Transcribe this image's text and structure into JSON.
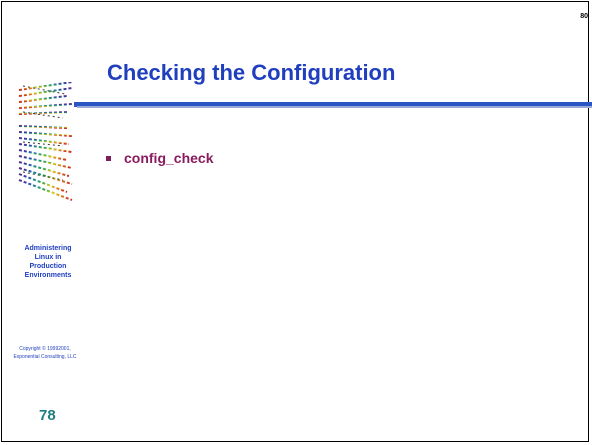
{
  "slide": {
    "number_top": "80",
    "title": "Checking the Configuration",
    "bullets": [
      {
        "text": "config_check"
      }
    ],
    "side_label": [
      "Administering",
      "Linux in",
      "Production",
      "Environments"
    ],
    "copyright": [
      "Copyright © 19992001,",
      "Exponential Consulting, LLC"
    ],
    "page_number": "78"
  },
  "colors": {
    "title": "#1f3fbf",
    "bullet_text": "#8a1b5e",
    "page_number": "#1f7f7f",
    "rule": "#2c55c4"
  },
  "icons": {
    "logo": "rainbow-dashed-logo-icon",
    "bullet": "square-bullet-icon"
  }
}
